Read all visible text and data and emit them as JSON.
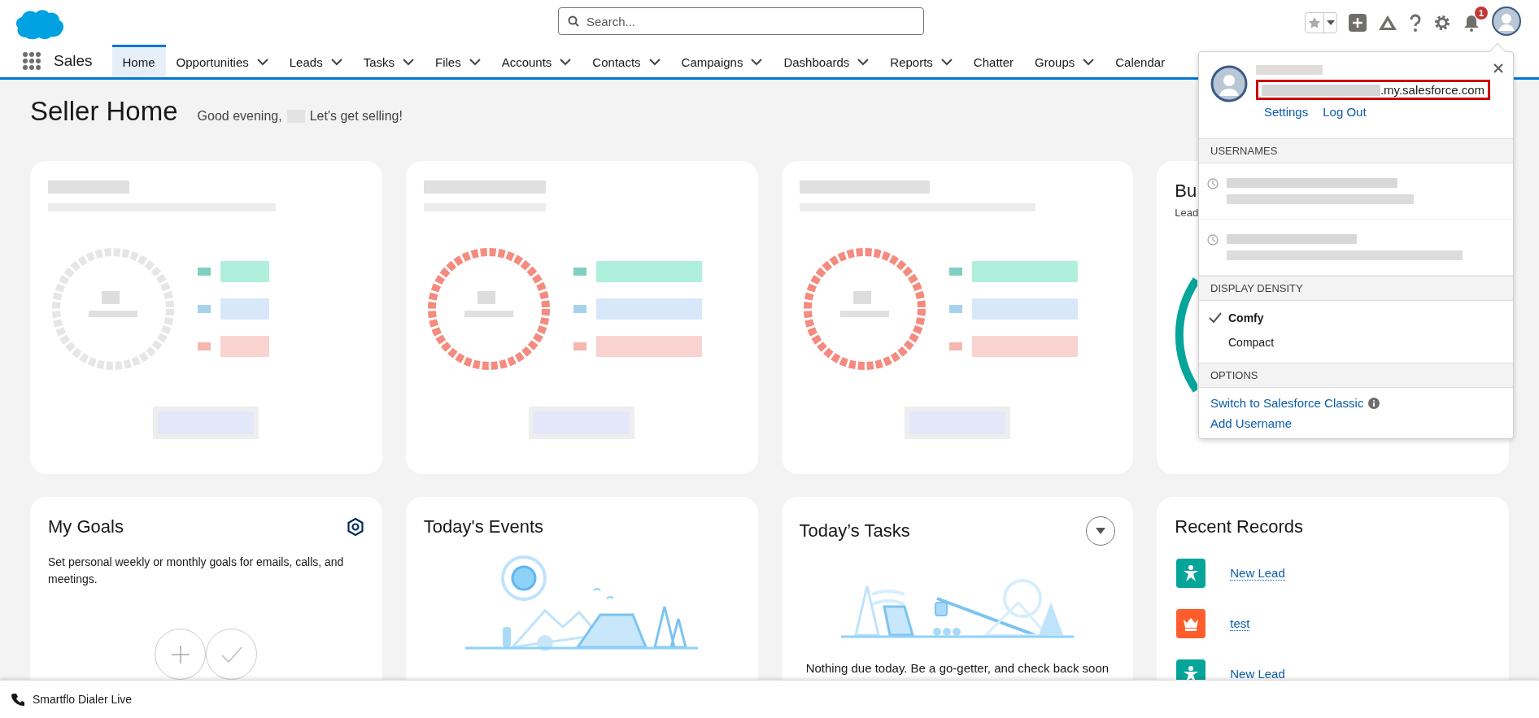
{
  "header": {
    "search": {
      "placeholder": "Search..."
    },
    "notification_count": "1"
  },
  "nav": {
    "app_name": "Sales",
    "tabs": [
      {
        "label": "Home",
        "selected": true,
        "menu": false
      },
      {
        "label": "Opportunities",
        "selected": false,
        "menu": true
      },
      {
        "label": "Leads",
        "selected": false,
        "menu": true
      },
      {
        "label": "Tasks",
        "selected": false,
        "menu": true
      },
      {
        "label": "Files",
        "selected": false,
        "menu": true
      },
      {
        "label": "Accounts",
        "selected": false,
        "menu": true
      },
      {
        "label": "Contacts",
        "selected": false,
        "menu": true
      },
      {
        "label": "Campaigns",
        "selected": false,
        "menu": true
      },
      {
        "label": "Dashboards",
        "selected": false,
        "menu": true
      },
      {
        "label": "Reports",
        "selected": false,
        "menu": true
      },
      {
        "label": "Chatter",
        "selected": false,
        "menu": false
      },
      {
        "label": "Groups",
        "selected": false,
        "menu": true
      },
      {
        "label": "Calendar",
        "selected": false,
        "menu": false
      }
    ]
  },
  "page": {
    "title": "Seller Home",
    "greeting_start": "Good evening,",
    "greeting_end": "Let's get selling!"
  },
  "summary_cards": [
    {
      "kind": "redacted",
      "color": "#e6e6e6"
    },
    {
      "kind": "redacted",
      "color": "#f58a7f"
    },
    {
      "kind": "redacted",
      "color": "#f58a7f"
    },
    {
      "kind": "partial",
      "title": "Bu",
      "subtitle": "Lead"
    }
  ],
  "goals": {
    "title": "My Goals",
    "text": "Set personal weekly or monthly goals for emails, calls, and meetings."
  },
  "events": {
    "title": "Today's Events"
  },
  "tasks": {
    "title": "Today’s Tasks",
    "message": "Nothing due today. Be a go-getter, and check back soon"
  },
  "recent_records": {
    "title": "Recent Records",
    "items": [
      {
        "label": "New Lead",
        "kind": "lead"
      },
      {
        "label": "test",
        "kind": "opportunity"
      },
      {
        "label": "New Lead",
        "kind": "lead"
      }
    ]
  },
  "user_menu": {
    "domain": ".my.salesforce.com",
    "links": [
      "Settings",
      "Log Out"
    ],
    "usernames_heading": "USERNAMES",
    "usernames": [
      {
        "kind": "redacted"
      },
      {
        "kind": "redacted"
      }
    ],
    "density_heading": "DISPLAY DENSITY",
    "density": [
      {
        "label": "Comfy",
        "selected": true
      },
      {
        "label": "Compact",
        "selected": false
      }
    ],
    "options_heading": "OPTIONS",
    "options": [
      {
        "label": "Switch to Salesforce Classic",
        "info": true
      },
      {
        "label": "Add Username",
        "info": false
      }
    ]
  },
  "footer": {
    "label": "Smartflo Dialer Live"
  }
}
